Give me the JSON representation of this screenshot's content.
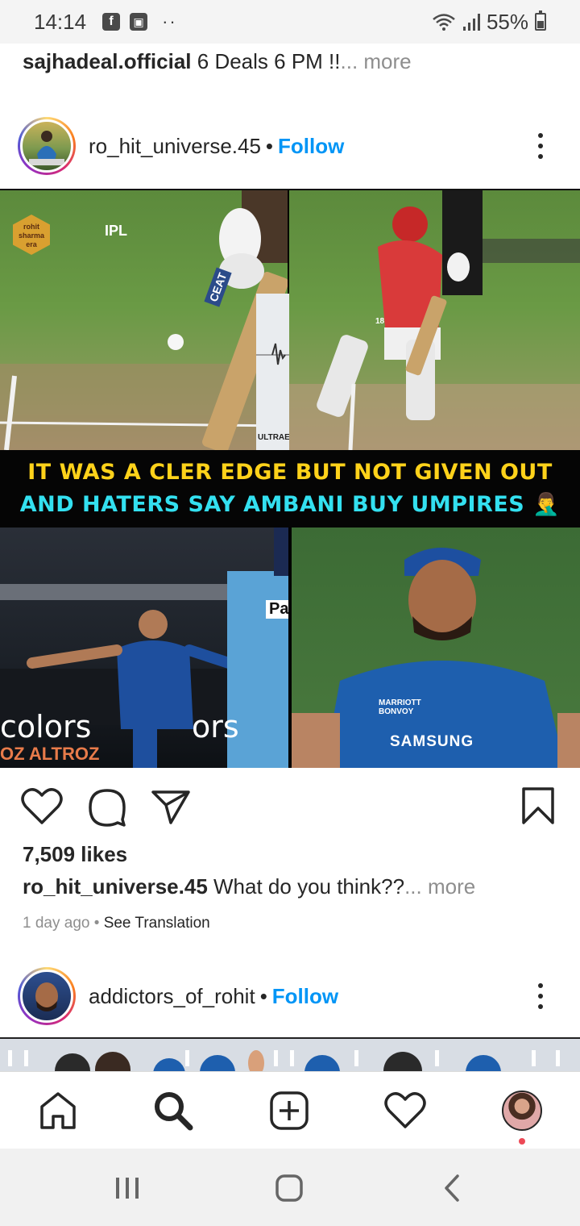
{
  "status_bar": {
    "time": "14:14",
    "notif_icons": [
      "f",
      "▣"
    ],
    "dots": "··",
    "battery": "55%"
  },
  "prev_post": {
    "username": "sajhadeal.official",
    "caption": "6 Deals 6 PM !!",
    "more": "... more"
  },
  "post": {
    "username": "ro_hit_universe.45",
    "separator": "•",
    "follow_label": "Follow",
    "image": {
      "top_left_logo": "rohit sharma era",
      "ipl_logo": "IPL",
      "bat_label": "CEAT",
      "snick_label": "ULTRAEDGE",
      "jersey_number": "18",
      "meme_line1": "IT WAS A CLER EDGE BUT NOT GIVEN OUT",
      "meme_line2": "AND HATERS SAY AMBANI BUY UMPIRES 🤦‍♂️",
      "umpire_shirt": "Pa",
      "ad_colors": "colors",
      "ad_colors2": "ors",
      "ad_altroz": "OZ ALTROZ",
      "jersey_sponsor": "SAMSUNG",
      "jersey_marriott": "MARRIOTT BONVOY"
    },
    "likes": "7,509 likes",
    "caption_username": "ro_hit_universe.45",
    "caption_text": "What do you think??",
    "caption_more": "... more",
    "time_ago": "1 day ago",
    "meta_sep": "•",
    "see_translation": "See Translation"
  },
  "next_post": {
    "username": "addictors_of_rohit",
    "separator": "•",
    "follow_label": "Follow"
  },
  "colors": {
    "follow": "#0095f6",
    "meme_yellow": "#ffd21a",
    "meme_cyan": "#33e0f0",
    "notification_dot": "#ed4956"
  },
  "bottom_nav": [
    "home-icon",
    "search-icon",
    "new-post-icon",
    "activity-heart-icon",
    "profile-avatar"
  ],
  "system_nav": [
    "recent-apps-icon",
    "home-button-icon",
    "back-icon"
  ]
}
